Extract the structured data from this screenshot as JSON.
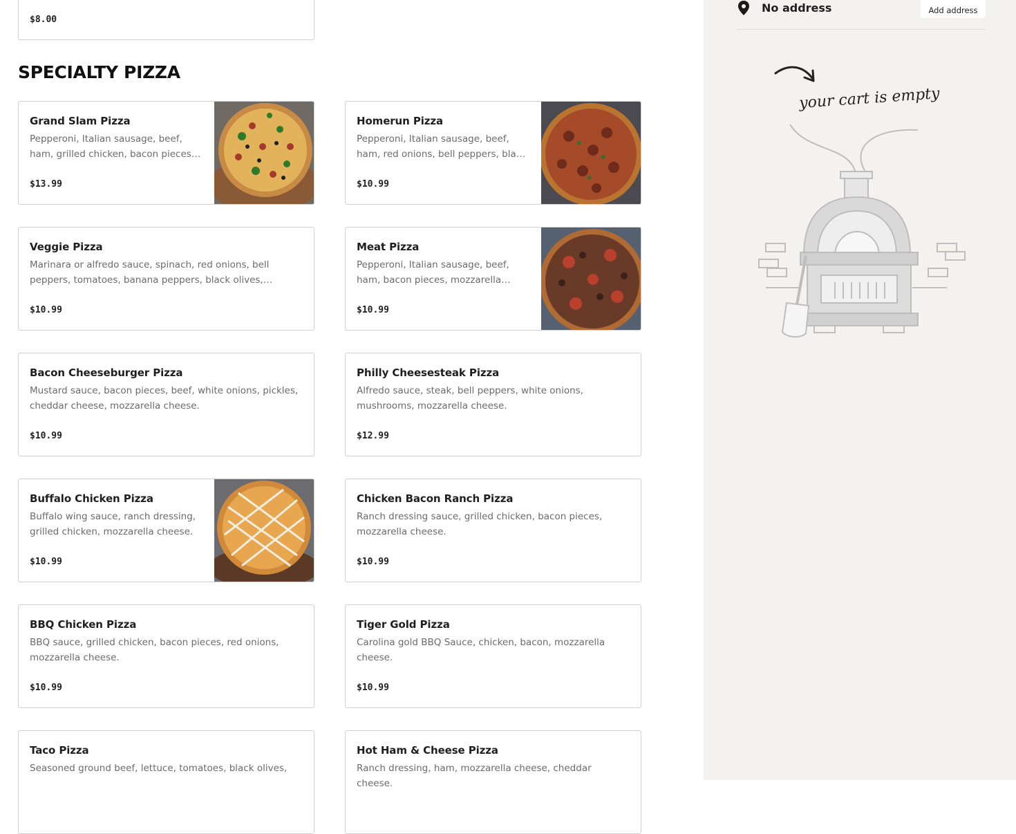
{
  "top_card": {
    "price": "$8.00"
  },
  "section": {
    "title": "SPECIALTY PIZZA"
  },
  "items": [
    {
      "name": "Grand Slam Pizza",
      "desc": "Pepperoni, Italian sausage, beef, ham, grilled chicken, bacon pieces, red onions, bell peppers, black olives, mushrooms, mozzarella cheese.",
      "price": "$13.99",
      "image": "grand-slam-pizza-photo"
    },
    {
      "name": "Homerun Pizza",
      "desc": "Pepperoni, Italian sausage, beef, ham, red onions, bell peppers, black olives, mozzarella cheese.",
      "price": "$10.99",
      "image": "homerun-pizza-photo"
    },
    {
      "name": "Veggie Pizza",
      "desc": "Marinara or alfredo sauce, spinach, red onions, bell peppers, tomatoes, banana peppers, black olives, mozzarella cheese.",
      "price": "$10.99"
    },
    {
      "name": "Meat Pizza",
      "desc": "Pepperoni, Italian sausage, beef, ham, bacon pieces, mozzarella cheese.",
      "price": "$10.99",
      "image": "meat-pizza-photo"
    },
    {
      "name": "Bacon Cheeseburger Pizza",
      "desc": "Mustard sauce, bacon pieces, beef, white onions, pickles, cheddar cheese, mozzarella cheese.",
      "price": "$10.99"
    },
    {
      "name": "Philly Cheesesteak Pizza",
      "desc": "Alfredo sauce, steak, bell peppers, white onions, mushrooms, mozzarella cheese.",
      "price": "$12.99"
    },
    {
      "name": "Buffalo Chicken Pizza",
      "desc": "Buffalo wing sauce, ranch dressing, grilled chicken, mozzarella cheese.",
      "price": "$10.99",
      "image": "buffalo-chicken-pizza-photo"
    },
    {
      "name": "Chicken Bacon Ranch Pizza",
      "desc": "Ranch dressing sauce, grilled chicken, bacon pieces, mozzarella cheese.",
      "price": "$10.99"
    },
    {
      "name": "BBQ Chicken Pizza",
      "desc": "BBQ sauce, grilled chicken, bacon pieces, red onions, mozzarella cheese.",
      "price": "$10.99"
    },
    {
      "name": "Tiger Gold Pizza",
      "desc": "Carolina gold BBQ Sauce, chicken, bacon, mozzarella cheese.",
      "price": "$10.99"
    },
    {
      "name": "Taco Pizza",
      "desc": "Seasoned ground beef, lettuce, tomatoes, black olives,",
      "price": ""
    },
    {
      "name": "Hot Ham & Cheese Pizza",
      "desc": "Ranch dressing, ham, mozzarella cheese, cheddar cheese.",
      "price": ""
    }
  ],
  "sidebar": {
    "address": "No address",
    "add_address": "Add address",
    "empty_message": "your cart is empty",
    "location_icon": "map-pin-icon",
    "illustration": "pizza-oven-illustration"
  },
  "colors": {
    "sidebar_bg": "#f3f2ef",
    "card_border": "#cfcfcf",
    "desc_text": "#6b6b6b"
  }
}
